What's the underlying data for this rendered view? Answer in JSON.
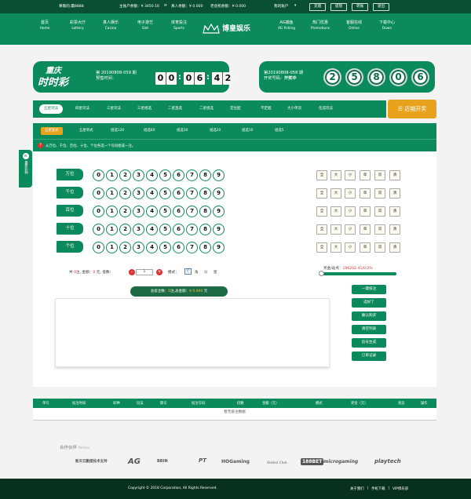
{
  "topbar": {
    "welcome": "尊敬的:赢8888",
    "main_balance": "主账户余额：¥ 3450.16",
    "main_balance_icon": "refresh-icon",
    "live_balance": "真人余额：¥ 0.000",
    "old_balance": "老虎机余额：¥ 0.000",
    "my_account": "我的账户",
    "buttons": [
      "充值",
      "提现",
      "转账",
      "退出"
    ]
  },
  "nav": {
    "items": [
      {
        "cn": "首页",
        "en": "Home"
      },
      {
        "cn": "彩票大厅",
        "en": "Lottery"
      },
      {
        "cn": "真人娱乐",
        "en": "Casino"
      },
      {
        "cn": "电子游艺",
        "en": "Slot"
      },
      {
        "cn": "体育投注",
        "en": "Sports"
      },
      {
        "cn": "AG捕鱼",
        "en": "AG fishing"
      },
      {
        "cn": "热门优惠",
        "en": "Promotions"
      },
      {
        "cn": "客服在线",
        "en": "Online"
      },
      {
        "cn": "下载中心",
        "en": "Down"
      }
    ],
    "logo_text": "博皇娱乐"
  },
  "current_draw": {
    "city": "重庆",
    "game": "时时彩",
    "period": "第 20190808-059 期",
    "label": "预售时间：",
    "countdown": [
      "0",
      "0",
      "0",
      "6",
      "4",
      "2"
    ]
  },
  "last_draw": {
    "period": "第20190808-058 期",
    "label": "开奖号码：",
    "status": "开奖中",
    "balls": [
      "2",
      "5",
      "8",
      "0",
      "6"
    ]
  },
  "play_tabs": [
    "五星玩法",
    "四星玩法",
    "三星玩法",
    "三星组选",
    "二星直选",
    "二星组选",
    "定位胆",
    "不定胆",
    "大小单双",
    "任选玩法"
  ],
  "trend_button": "近期开奖",
  "sub_tabs": [
    "五星复式",
    "五星单式",
    "组选120",
    "组选60",
    "组选30",
    "组选20",
    "组选10",
    "组选5"
  ],
  "hint": "从万位、千位、百位、十位、个位各选一个号码组成一注。",
  "positions": [
    "万位",
    "千位",
    "百位",
    "十位",
    "个位"
  ],
  "digits": [
    "0",
    "1",
    "2",
    "3",
    "4",
    "5",
    "6",
    "7",
    "8",
    "9"
  ],
  "quick": [
    "全",
    "大",
    "小",
    "单",
    "双",
    "清"
  ],
  "bet": {
    "prefix": "共",
    "count": "0",
    "note_label": "注, 金额：",
    "amount": "0",
    "unit": "元",
    "multiple_label": "倍数：",
    "minus": "-",
    "multiple": "1",
    "plus": "+",
    "mode_label": "模式：",
    "modes": [
      "元",
      "角",
      "分",
      "厘"
    ]
  },
  "prize": {
    "label": "奖金/返点：",
    "value": "196202.41/0.0%"
  },
  "summary": {
    "left": "总投注数：",
    "count": "0",
    "mid": "注,总金额：",
    "amount": "¥ 0.000",
    "unit": "元"
  },
  "right_buttons": [
    "一键投注",
    "选好了",
    "确认购买",
    "清空列表",
    "追号生成",
    "订单记录"
  ],
  "side_button": "最新彩种",
  "table": {
    "headers": [
      "单号",
      "投注时间",
      "彩种",
      "玩法",
      "期号",
      "投注号码",
      "倍数",
      "金额（元）",
      "模式",
      "奖金（元）",
      "状态",
      "操作"
    ],
    "empty": "暂无投注数据"
  },
  "partners": {
    "title": "合作伙伴",
    "subtitle": "Partner",
    "logos": [
      "新天云勤提技术支持",
      "AG",
      "BBIN",
      "PT",
      "HOGaming",
      "Global Club",
      "188BET",
      "microgaming",
      "playtech"
    ]
  },
  "footer": {
    "copyright": "Copyright © 2018 Corporation, All Rights Reserved.",
    "links": [
      "关于我们",
      "手机下载",
      "VIP俱乐部"
    ]
  }
}
